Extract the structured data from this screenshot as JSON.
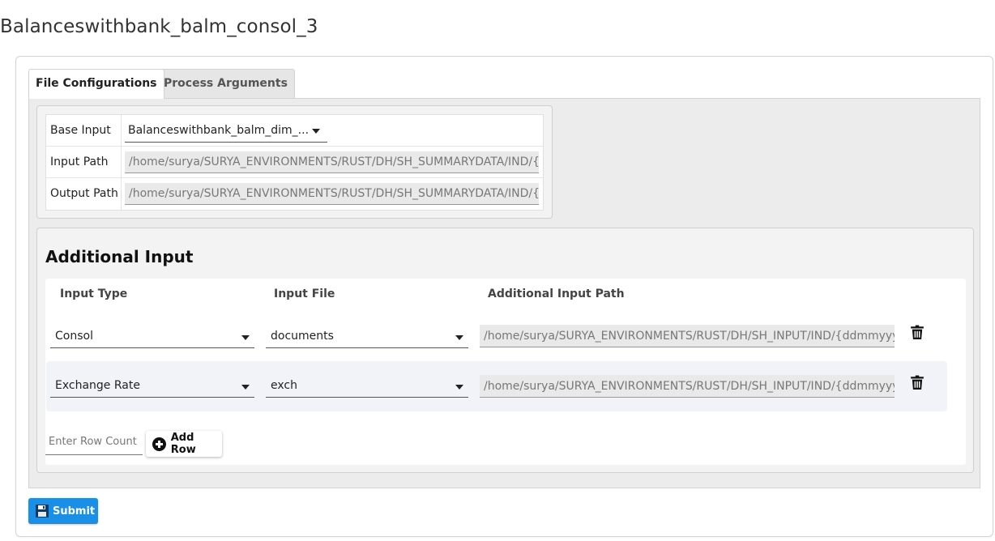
{
  "page": {
    "title": "Balanceswithbank_balm_consol_3"
  },
  "tabs": [
    {
      "label": "File Configurations",
      "active": true
    },
    {
      "label": "Process Arguments",
      "active": false
    }
  ],
  "base": {
    "base_input_label": "Base Input",
    "base_input_value": "Balanceswithbank_balm_dim_...",
    "input_path_label": "Input Path",
    "input_path_value": "/home/surya/SURYA_ENVIRONMENTS/RUST/DH/SH_SUMMARYDATA/IND/{ddr",
    "output_path_label": "Output Path",
    "output_path_value": "/home/surya/SURYA_ENVIRONMENTS/RUST/DH/SH_SUMMARYDATA/IND/{ddr"
  },
  "additional": {
    "title": "Additional Input",
    "headers": {
      "input_type": "Input Type",
      "input_file": "Input File",
      "path": "Additional Input Path"
    },
    "rows": [
      {
        "input_type": "Consol",
        "input_file": "documents",
        "path": "/home/surya/SURYA_ENVIRONMENTS/RUST/DH/SH_INPUT/IND/{ddmmyyyy}/("
      },
      {
        "input_type": "Exchange Rate",
        "input_file": "exch",
        "path": "/home/surya/SURYA_ENVIRONMENTS/RUST/DH/SH_INPUT/IND/{ddmmyyyy}/"
      }
    ],
    "row_count_placeholder": "Enter Row Count",
    "add_row_label": "Add Row"
  },
  "submit_label": "Submit",
  "colors": {
    "accent": "#1a8fe8",
    "panel": "#ececec"
  }
}
